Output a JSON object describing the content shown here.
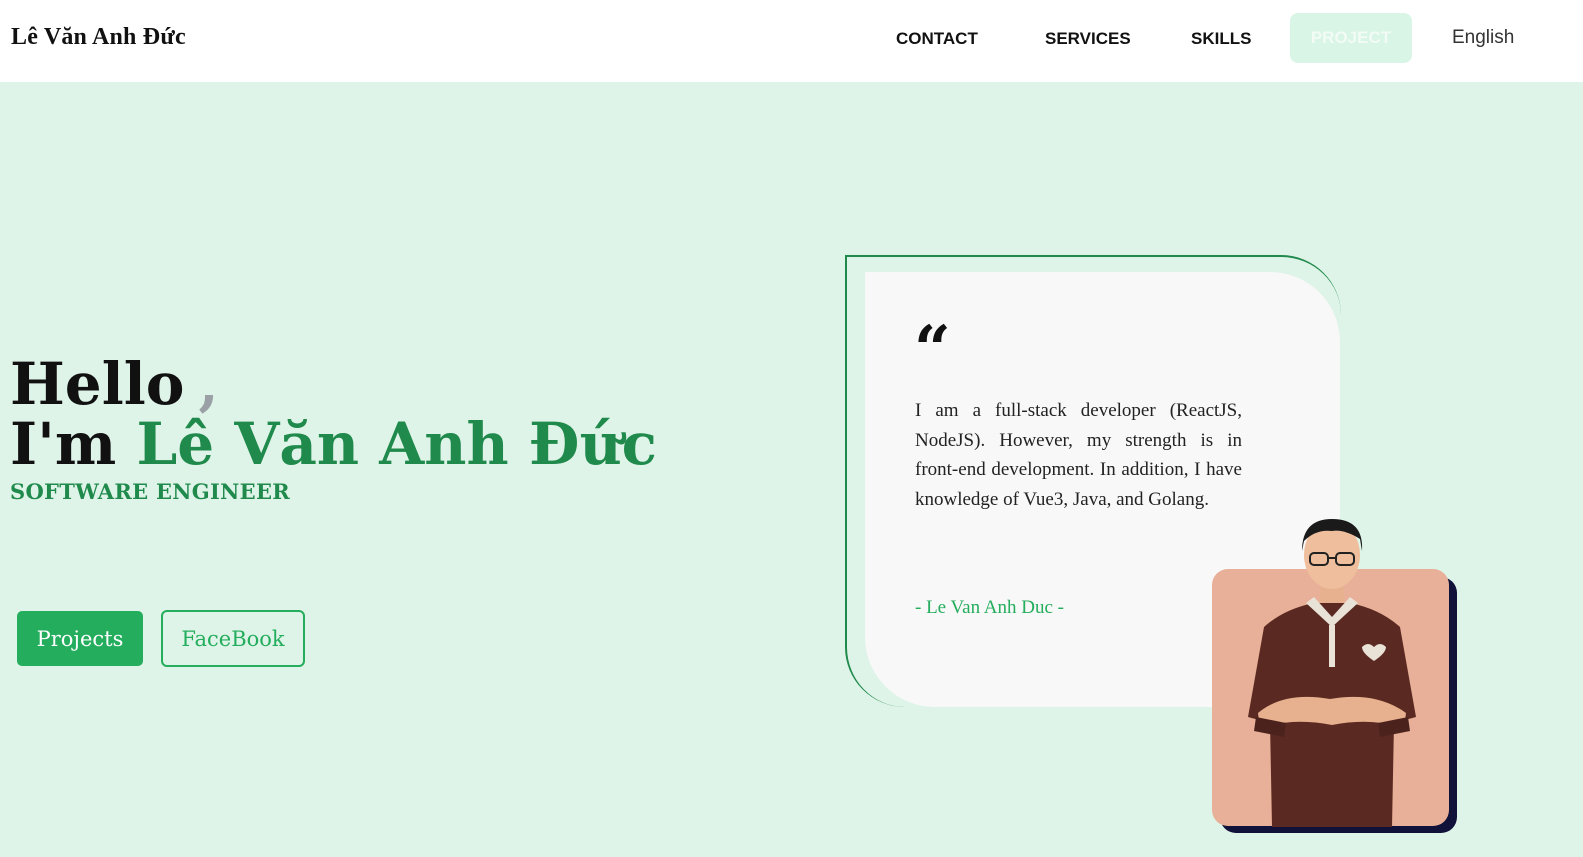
{
  "nav": {
    "brand": "Lê Văn Anh Đức",
    "links": [
      "CONTACT",
      "SERVICES",
      "SKILLS",
      "PROJECT"
    ],
    "language": "English"
  },
  "hero": {
    "hello": "Hello",
    "hello_comma": ",",
    "im": "I'm ",
    "name": "Lê Văn Anh Đức",
    "role": "SOFTWARE ENGINEER",
    "buttons": {
      "projects": "Projects",
      "facebook": "FaceBook"
    }
  },
  "quote": {
    "mark": "“",
    "text": "I am a full-stack developer (ReactJS, NodeJS). However, my strength is in front-end development. In addition, I have knowledge of Vue3, Java, and Golang.",
    "author": "- Le Van Anh Duc -"
  },
  "colors": {
    "background": "#dff4e8",
    "accent": "#23ad5c",
    "name_green": "#1f8a4c",
    "photo_bg": "#e8b098",
    "photo_shadow": "#11123a"
  }
}
